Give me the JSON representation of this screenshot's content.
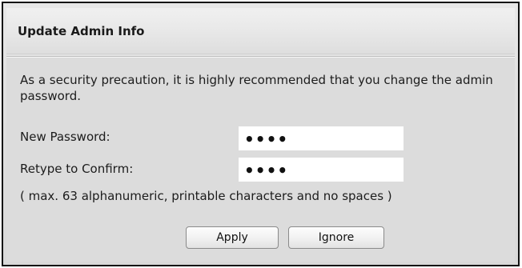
{
  "dialog": {
    "title": "Update Admin Info",
    "message": "As a security precaution, it is highly recommended that you change the admin password.",
    "fields": {
      "new_password": {
        "label": "New Password:",
        "value": "••••"
      },
      "confirm_password": {
        "label": "Retype to Confirm:",
        "value": "••••"
      }
    },
    "hint": "( max. 63 alphanumeric, printable characters and no spaces )",
    "buttons": {
      "apply": "Apply",
      "ignore": "Ignore"
    }
  },
  "colors": {
    "background": "#dcdcdc",
    "border": "#111111",
    "input_background": "#ffffff"
  }
}
